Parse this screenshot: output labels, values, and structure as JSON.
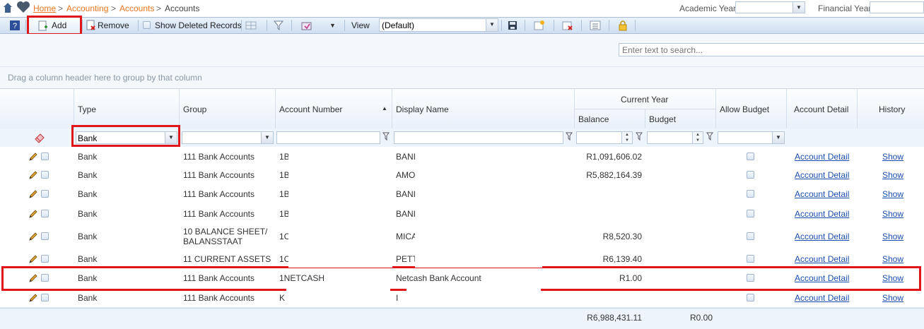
{
  "breadcrumb": {
    "home": "Home",
    "sep": ">",
    "accounting": "Accounting",
    "accounts_link": "Accounts",
    "current": "Accounts"
  },
  "top_filters": {
    "academic_year_label": "Academic Year",
    "academic_year_value": "",
    "financial_year_label": "Financial Year",
    "financial_year_value": ""
  },
  "toolbar": {
    "add_label": "Add",
    "remove_label": "Remove",
    "show_deleted_label": "Show Deleted Records",
    "view_label": "View",
    "view_value": "(Default)"
  },
  "search": {
    "placeholder": "Enter text to search..."
  },
  "grouping": {
    "hint": "Drag a column header here to group by that column"
  },
  "columns": {
    "type": "Type",
    "group": "Group",
    "account_number": "Account Number",
    "display_name": "Display Name",
    "current_year": "Current Year",
    "balance": "Balance",
    "budget": "Budget",
    "allow_budget": "Allow Budget",
    "account_detail": "Account Detail",
    "history": "History"
  },
  "filters": {
    "type_value": "Bank"
  },
  "rows": [
    {
      "type": "Bank",
      "group": "111 Bank Accounts",
      "account_number": "1B",
      "display_name": "BANI",
      "balance": "R1,091,606.02",
      "budget": "",
      "detail": "Account Detail",
      "history": "Show"
    },
    {
      "type": "Bank",
      "group": "111 Bank Accounts",
      "account_number": "1B",
      "display_name": "AMO",
      "balance": "R5,882,164.39",
      "budget": "",
      "detail": "Account Detail",
      "history": "Show"
    },
    {
      "type": "Bank",
      "group": "111 Bank Accounts",
      "account_number": "1B",
      "display_name": "BANI",
      "balance": "",
      "budget": "",
      "detail": "Account Detail",
      "history": "Show"
    },
    {
      "type": "Bank",
      "group": "111 Bank Accounts",
      "account_number": "1B",
      "display_name": "BANI",
      "balance": "",
      "budget": "",
      "detail": "Account Detail",
      "history": "Show"
    },
    {
      "type": "Bank",
      "group": "10 BALANCE SHEET/ BALANSSTAAT",
      "account_number": "1C",
      "display_name": "MICA",
      "balance": "R8,520.30",
      "budget": "",
      "detail": "Account Detail",
      "history": "Show"
    },
    {
      "type": "Bank",
      "group": "11 CURRENT ASSETS",
      "account_number": "1C",
      "display_name": "PETT",
      "balance": "R6,139.40",
      "budget": "",
      "detail": "Account Detail",
      "history": "Show"
    },
    {
      "type": "Bank",
      "group": "111 Bank Accounts",
      "account_number": "1NETCASH",
      "display_name": "Netcash Bank Account",
      "balance": "R1.00",
      "budget": "",
      "detail": "Account Detail",
      "history": "Show"
    },
    {
      "type": "Bank",
      "group": "111 Bank Accounts",
      "account_number": "K",
      "display_name": "I",
      "balance": "",
      "budget": "",
      "detail": "Account Detail",
      "history": "Show"
    }
  ],
  "totals": {
    "balance": "R6,988,431.11",
    "budget": "R0.00"
  },
  "colors": {
    "highlight": "#e0141b",
    "link": "#1b4fb3",
    "breadcrumb": "#e8741e"
  }
}
